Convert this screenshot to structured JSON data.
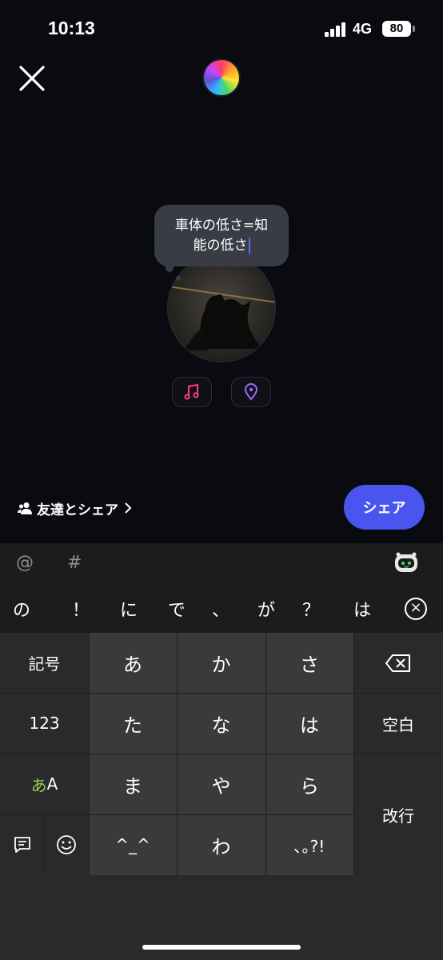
{
  "status": {
    "time": "10:13",
    "network": "4G",
    "battery": "80"
  },
  "bubble": {
    "line1": "車体の低さ=知",
    "line2": "能の低さ"
  },
  "footer": {
    "share_friends": "友達とシェア",
    "share_button": "シェア"
  },
  "keyboard": {
    "top_symbols": [
      "@",
      "#"
    ],
    "candidates": [
      "の",
      "！",
      "に",
      "で",
      "、",
      "が",
      "？",
      "は"
    ],
    "keys": {
      "kigou": "記号",
      "a": "あ",
      "ka": "か",
      "sa": "さ",
      "num": "123",
      "ta": "た",
      "na": "な",
      "ha": "は",
      "space": "空白",
      "kana_a": "あ",
      "kana_A": "A",
      "ma": "ま",
      "ya": "や",
      "ra": "ら",
      "enter": "改行",
      "emoticon": "^_^",
      "wa": "わ",
      "punct": "､｡?!"
    }
  },
  "colors": {
    "accent": "#4a55f0",
    "background": "#0a0b10",
    "music_icon": "#ff3b7a",
    "location_icon": "#9b6bff"
  }
}
